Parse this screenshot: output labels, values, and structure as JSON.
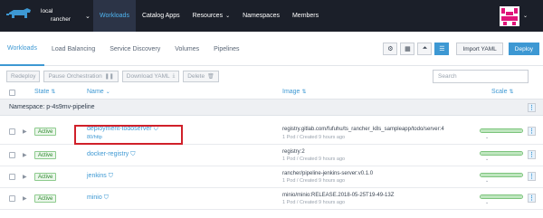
{
  "header": {
    "cluster_line1": "local",
    "cluster_line2": "rancher",
    "nav": [
      {
        "label": "Workloads",
        "active": true,
        "dropdown": false
      },
      {
        "label": "Catalog Apps",
        "active": false,
        "dropdown": false
      },
      {
        "label": "Resources",
        "active": false,
        "dropdown": true
      },
      {
        "label": "Namespaces",
        "active": false,
        "dropdown": false
      },
      {
        "label": "Members",
        "active": false,
        "dropdown": false
      }
    ],
    "caret": "⌄",
    "avatar_color": "#e0157a"
  },
  "subnav": {
    "tabs": [
      "Workloads",
      "Load Balancing",
      "Service Discovery",
      "Volumes",
      "Pipelines"
    ],
    "import_label": "Import YAML",
    "deploy_label": "Deploy"
  },
  "bulk": {
    "redeploy": "Redeploy",
    "pause": "Pause Orchestration",
    "download": "Download YAML",
    "delete": "Delete",
    "search_placeholder": "Search"
  },
  "table": {
    "col_state": "State",
    "col_name": "Name",
    "col_image": "Image",
    "col_scale": "Scale",
    "namespace_label": "Namespace: p-4s9mv-pipeline",
    "rows": [
      {
        "state": "Active",
        "name": "deployment-todoserver",
        "sublink": "80/http",
        "image": "registry.gitlab.com/fufuhu/ts_rancher_k8s_sampleapp/todo/server:4",
        "meta": "1 Pod / Created 9 hours ago",
        "scale": 1.0
      },
      {
        "state": "Active",
        "name": "docker-registry",
        "sublink": "",
        "image": "registry:2",
        "meta": "1 Pod / Created 9 hours ago",
        "scale": 1.0
      },
      {
        "state": "Active",
        "name": "jenkins",
        "sublink": "",
        "image": "rancher/pipeline-jenkins-server:v0.1.0",
        "meta": "1 Pod / Created 9 hours ago",
        "scale": 1.0
      },
      {
        "state": "Active",
        "name": "minio",
        "sublink": "",
        "image": "minio/minio:RELEASE.2018-05-25T19-49-13Z",
        "meta": "1 Pod / Created 9 hours ago",
        "scale": 1.0
      }
    ]
  },
  "colors": {
    "accent": "#3d98d3",
    "topbar": "#1b1f29",
    "active_green": "#2f8a2f",
    "highlight_red": "#d0202a"
  }
}
